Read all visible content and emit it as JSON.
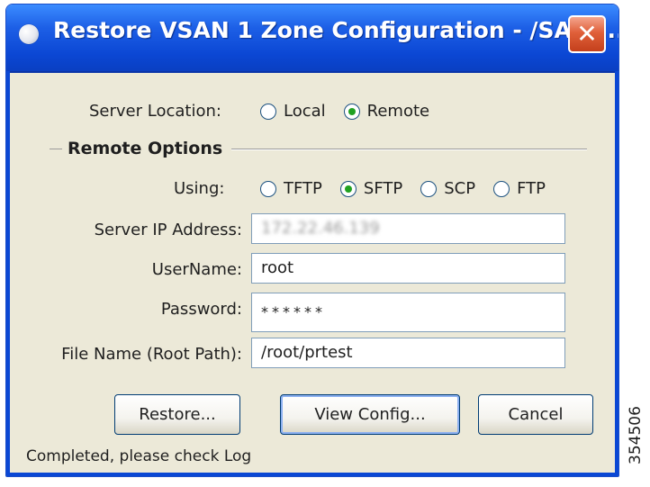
{
  "window": {
    "title": "Restore VSAN 1 Zone Configuration - /SAN/...",
    "close_glyph": "✕",
    "app_icon": "app-icon",
    "colors": {
      "titlebar": "#0b47d4",
      "body": "#ece9d8",
      "close_button": "#e0603a",
      "radio_checked": "#21a121"
    }
  },
  "server_location": {
    "label": "Server Location:",
    "options": [
      "Local",
      "Remote"
    ],
    "selected": "Remote"
  },
  "remote_options": {
    "group_title": "Remote Options",
    "using_label": "Using:",
    "protocols": [
      "TFTP",
      "SFTP",
      "SCP",
      "FTP"
    ],
    "selected": "SFTP"
  },
  "fields": {
    "server_ip": {
      "label": "Server IP Address:",
      "value": "172.22.46.139"
    },
    "username": {
      "label": "UserName:",
      "value": "root"
    },
    "password": {
      "label": "Password:",
      "value": "******"
    },
    "file_name": {
      "label": "File Name (Root Path):",
      "value": "/root/prtest"
    }
  },
  "buttons": {
    "restore": "Restore...",
    "view_config": "View Config...",
    "cancel": "Cancel"
  },
  "status_text": "Completed, please check Log",
  "figure_id": "354506"
}
